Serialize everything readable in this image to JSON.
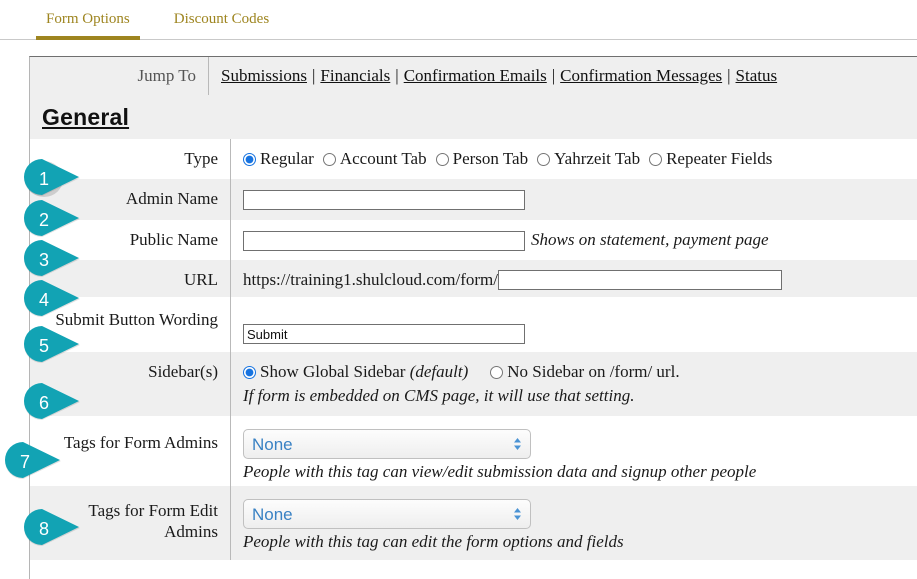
{
  "tabs": [
    {
      "label": "Form Options",
      "active": true
    },
    {
      "label": "Discount Codes",
      "active": false
    }
  ],
  "jump_to": {
    "label": "Jump To",
    "links": [
      "Submissions",
      "Financials",
      "Confirmation Emails",
      "Confirmation Messages",
      "Status"
    ],
    "separator": "|"
  },
  "section": {
    "title": "General"
  },
  "colors": {
    "tab_text": "#9e8520",
    "badge": "#12a3b4",
    "row_alt": "#efefef",
    "select_text": "#3a82c4",
    "radio_accent": "#1773e0"
  },
  "rows": [
    {
      "num": "1",
      "label": "Type",
      "options": [
        {
          "label": "Regular",
          "checked": true
        },
        {
          "label": "Account Tab",
          "checked": false
        },
        {
          "label": "Person Tab",
          "checked": false
        },
        {
          "label": "Yahrzeit Tab",
          "checked": false
        },
        {
          "label": "Repeater Fields",
          "checked": false
        }
      ]
    },
    {
      "num": "2",
      "label": "Admin Name",
      "value": "",
      "placeholder": ""
    },
    {
      "num": "3",
      "label": "Public Name",
      "value": "",
      "placeholder": "",
      "note": "Shows on statement, payment page"
    },
    {
      "num": "4",
      "label": "URL",
      "prefix": "https://training1.shulcloud.com/form/",
      "value": "",
      "placeholder": ""
    },
    {
      "num": "5",
      "label": "Submit Button Wording",
      "value": "Submit",
      "placeholder": ""
    },
    {
      "num": "6",
      "label": "Sidebar(s)",
      "options": [
        {
          "label": "Show Global Sidebar (default)",
          "checked": true
        },
        {
          "label": "No Sidebar on /form/ url.",
          "checked": false
        }
      ],
      "note": "If form is embedded on CMS page, it will use that setting."
    },
    {
      "num": "7",
      "label": "Tags for Form Admins",
      "select_value": "None",
      "note": "People with this tag can view/edit submission data and signup other people"
    },
    {
      "num": "8",
      "label": "Tags for Form Edit Admins",
      "select_value": "None",
      "note": "People with this tag can edit the form options and fields"
    }
  ],
  "radio_labels": {
    "sidebar_global_main": "Show Global Sidebar ",
    "sidebar_global_default": "(default)"
  }
}
